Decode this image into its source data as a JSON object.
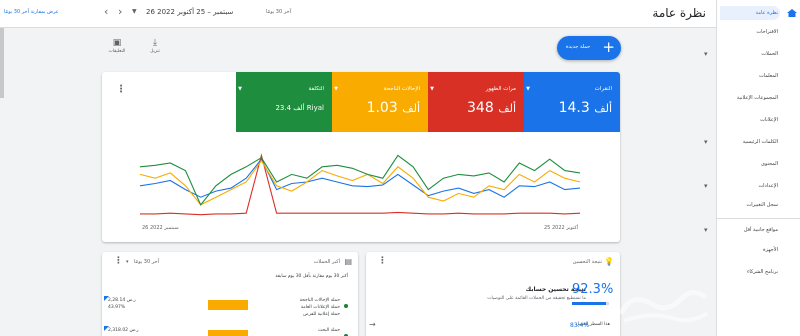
{
  "header": {
    "title": "نظرة عامة",
    "date_range": "26 سبتمبر – 25 أكتوبر 2022",
    "date_preset": "آخر 30 يومًا",
    "date_preset_value": "آخر 30 يومًا",
    "compare_link": "عرض بمقارنة آخر 30 يومًا"
  },
  "sidebar": {
    "items": [
      {
        "label": "نظرة عامة",
        "expandable": false
      },
      {
        "label": "الاقتراحات",
        "expandable": false
      },
      {
        "label": "الحملات",
        "expandable": true
      },
      {
        "label": "المعلمات",
        "expandable": false
      },
      {
        "label": "المجموعات الإعلانية",
        "expandable": false
      },
      {
        "label": "الإعلانات",
        "expandable": false
      },
      {
        "label": "الكلمات الرئيسية",
        "expandable": true
      },
      {
        "label": "المحتوى",
        "expandable": false
      },
      {
        "label": "الإعدادات",
        "expandable": true
      },
      {
        "label": "سجل التغييرات",
        "expandable": false
      },
      {
        "label": "مواقع جانبية أقل",
        "expandable": true
      },
      {
        "label": "الأجهزة",
        "expandable": false
      },
      {
        "label": "برنامج الشركاء",
        "expandable": false
      }
    ]
  },
  "actions": {
    "new_campaign": "حملة جديدة",
    "download": "تنزيل",
    "feedback": "التعليقات"
  },
  "metrics": [
    {
      "label": "النقرات",
      "value": "14.3",
      "unit": "ألف",
      "color": "#1a73e8"
    },
    {
      "label": "مرات الظهور",
      "value": "348",
      "unit": "ألف",
      "color": "#d93025"
    },
    {
      "label": "الإحالات الناجحة",
      "value": "1.03",
      "unit": "ألف",
      "color": "#f9ab00"
    },
    {
      "label": "التكلفة",
      "value": "23.4 ألف Riyal",
      "unit": "",
      "color": "#1e8e3e"
    }
  ],
  "chart_data": {
    "type": "line",
    "x_start_label": "26 سبتمبر 2022",
    "x_end_label": "25 أكتوبر 2022",
    "x": [
      1,
      2,
      3,
      4,
      5,
      6,
      7,
      8,
      9,
      10,
      11,
      12,
      13,
      14,
      15,
      16,
      17,
      18,
      19,
      20,
      21,
      22,
      23,
      24,
      25,
      26,
      27,
      28,
      29,
      30
    ],
    "series": [
      {
        "color": "#1a73e8",
        "values": [
          45,
          48,
          52,
          40,
          30,
          38,
          42,
          55,
          80,
          40,
          48,
          50,
          55,
          50,
          45,
          44,
          46,
          60,
          46,
          32,
          38,
          42,
          35,
          40,
          30,
          45,
          44,
          50,
          40,
          42
        ]
      },
      {
        "color": "#d93025",
        "values": [
          8,
          8,
          9,
          8,
          7,
          8,
          8,
          9,
          85,
          9,
          9,
          9,
          9,
          9,
          9,
          9,
          9,
          10,
          9,
          8,
          8,
          9,
          8,
          8,
          8,
          9,
          9,
          9,
          8,
          9
        ]
      },
      {
        "color": "#f9ab00",
        "values": [
          60,
          55,
          62,
          45,
          20,
          30,
          40,
          50,
          78,
          45,
          38,
          50,
          65,
          58,
          52,
          60,
          48,
          70,
          55,
          30,
          25,
          35,
          30,
          45,
          40,
          60,
          50,
          65,
          55,
          50
        ]
      },
      {
        "color": "#1e8e3e",
        "values": [
          70,
          72,
          75,
          65,
          20,
          45,
          60,
          70,
          82,
          50,
          60,
          55,
          70,
          72,
          68,
          60,
          55,
          85,
          70,
          40,
          55,
          60,
          58,
          62,
          50,
          75,
          65,
          80,
          65,
          62
        ]
      }
    ],
    "ylim": [
      0,
      100
    ]
  },
  "opt_card": {
    "header": "نتيجة التحسين",
    "title": "نتيجة تحسين حسابك",
    "subtitle": "ما تستطيع تحقيقه من الحملات القائمة على التوصيات",
    "score": "92.3%",
    "score_fraction": 0.923,
    "row_label": "هذا السطر للعميل",
    "row_value": "83.4%"
  },
  "campaigns_card": {
    "header": "أكبر الحملات",
    "range": "آخر 30 يومًا",
    "subtitle": "أكبر 30 يوم مقارنة بأقل 30 يوم سابقة",
    "rows": [
      {
        "t1": "حملة الإحالات الناجحة",
        "t2": "حملة الإعلانات العامة",
        "t3": "حملة إعلانية للفرص",
        "v1": "2,28.14 ر.س",
        "v2": "43.97%"
      },
      {
        "t1": "حملة البحث",
        "t2": "",
        "t3": "",
        "v1": "2,318.02 ر.س",
        "v2": ""
      }
    ]
  }
}
